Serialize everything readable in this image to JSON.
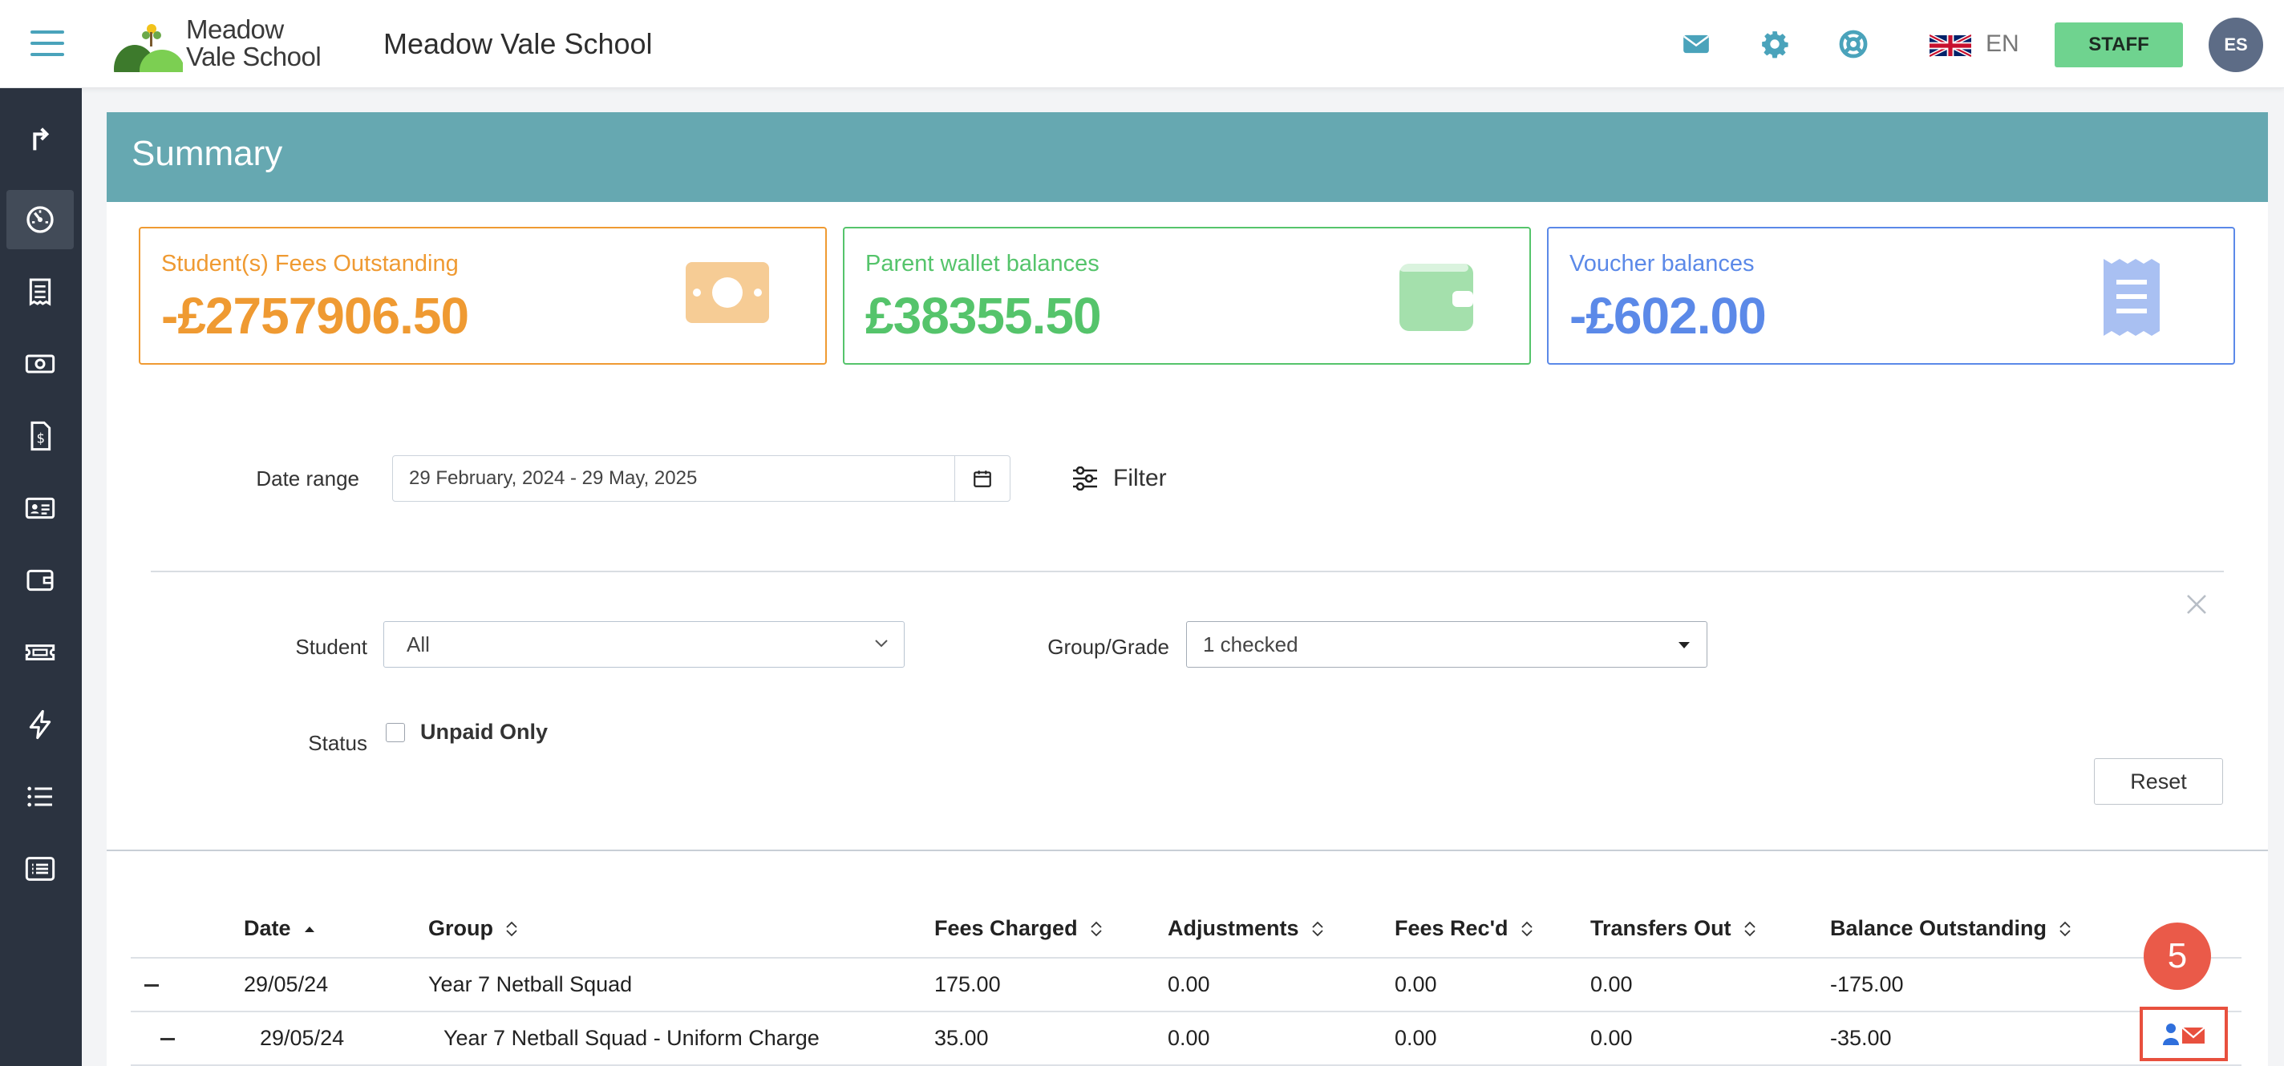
{
  "header": {
    "logo_line1": "Meadow",
    "logo_line2": "Vale School",
    "school_name": "Meadow Vale School",
    "language": "EN",
    "staff_label": "STAFF",
    "avatar_initials": "ES"
  },
  "sidebar": {
    "items": [
      {
        "icon": "exit-arrow-icon"
      },
      {
        "icon": "dashboard-gauge-icon",
        "active": true
      },
      {
        "icon": "receipt-icon"
      },
      {
        "icon": "cash-icon"
      },
      {
        "icon": "invoice-dollar-icon"
      },
      {
        "icon": "id-card-icon"
      },
      {
        "icon": "wallet-icon"
      },
      {
        "icon": "ticket-icon"
      },
      {
        "icon": "lightning-icon"
      },
      {
        "icon": "list-icon"
      },
      {
        "icon": "detail-list-icon"
      }
    ]
  },
  "summary": {
    "title": "Summary",
    "cards": [
      {
        "label": "Student(s) Fees Outstanding",
        "value": "-£2757906.50",
        "color": "#ef9a32",
        "icon": "cash-icon"
      },
      {
        "label": "Parent wallet balances",
        "value": "£38355.50",
        "color": "#55c46b",
        "icon": "wallet-icon"
      },
      {
        "label": "Voucher balances",
        "value": "-£602.00",
        "color": "#5b89e8",
        "icon": "receipt-icon"
      }
    ]
  },
  "filters": {
    "date_range_label": "Date range",
    "date_range_value": "29 February, 2024 - 29 May, 2025",
    "filter_label": "Filter",
    "student_label": "Student",
    "student_value": "All",
    "group_label": "Group/Grade",
    "group_value": "1 checked",
    "status_label": "Status",
    "unpaid_only_label": "Unpaid Only",
    "unpaid_only_checked": false,
    "reset_label": "Reset"
  },
  "table": {
    "columns": [
      "Date",
      "Group",
      "Fees Charged",
      "Adjustments",
      "Fees Rec'd",
      "Transfers Out",
      "Balance Outstanding"
    ],
    "rows": [
      {
        "date": "29/05/24",
        "group": "Year 7 Netball Squad",
        "fees_charged": "175.00",
        "adjustments": "0.00",
        "fees_recd": "0.00",
        "transfers_out": "0.00",
        "balance": "-175.00"
      },
      {
        "date": "29/05/24",
        "group": "Year 7 Netball Squad - Uniform Charge",
        "fees_charged": "35.00",
        "adjustments": "0.00",
        "fees_recd": "0.00",
        "transfers_out": "0.00",
        "balance": "-35.00"
      }
    ]
  },
  "annotation": {
    "step": "5",
    "color": "#e8503e"
  }
}
